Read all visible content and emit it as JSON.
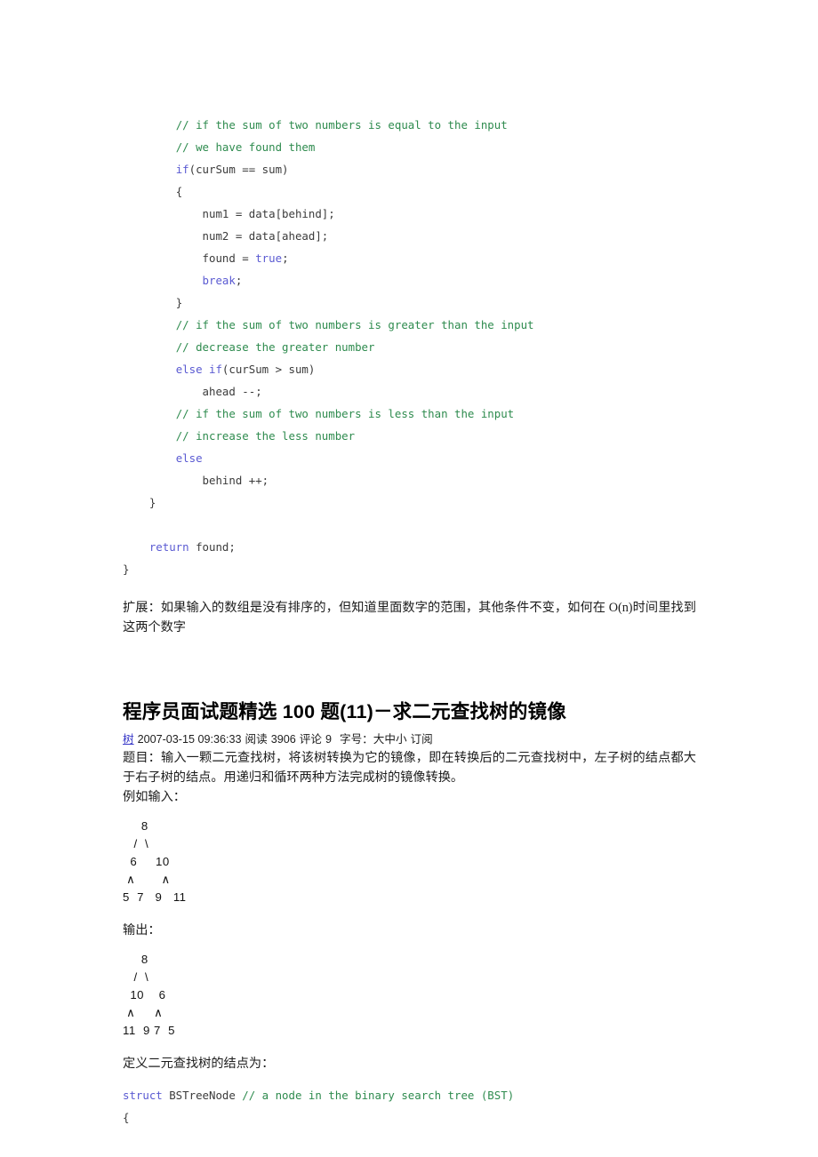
{
  "document": {
    "background_color": "#ffffff",
    "text_color": "#1d1d1d",
    "comment_color": "#2e8b4e",
    "keyword_color": "#5a5ad2",
    "link_color": "#3a3ac8"
  },
  "code_block_top": {
    "lines": [
      {
        "indent": 8,
        "segments": [
          {
            "t": "comment",
            "s": "// if the sum of two numbers is equal to the input"
          }
        ]
      },
      {
        "indent": 8,
        "segments": [
          {
            "t": "comment",
            "s": "// we have found them"
          }
        ]
      },
      {
        "indent": 8,
        "segments": [
          {
            "t": "keyword",
            "s": "if"
          },
          {
            "t": "plain",
            "s": "(curSum == sum)"
          }
        ]
      },
      {
        "indent": 8,
        "segments": [
          {
            "t": "plain",
            "s": "{"
          }
        ]
      },
      {
        "indent": 12,
        "segments": [
          {
            "t": "plain",
            "s": "num1 = data[behind];"
          }
        ]
      },
      {
        "indent": 12,
        "segments": [
          {
            "t": "plain",
            "s": "num2 = data[ahead];"
          }
        ]
      },
      {
        "indent": 12,
        "segments": [
          {
            "t": "plain",
            "s": "found = "
          },
          {
            "t": "keyword",
            "s": "true"
          },
          {
            "t": "plain",
            "s": ";"
          }
        ]
      },
      {
        "indent": 12,
        "segments": [
          {
            "t": "keyword",
            "s": "break"
          },
          {
            "t": "plain",
            "s": ";"
          }
        ]
      },
      {
        "indent": 8,
        "segments": [
          {
            "t": "plain",
            "s": "}"
          }
        ]
      },
      {
        "indent": 8,
        "segments": [
          {
            "t": "comment",
            "s": "// if the sum of two numbers is greater than the input"
          }
        ]
      },
      {
        "indent": 8,
        "segments": [
          {
            "t": "comment",
            "s": "// decrease the greater number"
          }
        ]
      },
      {
        "indent": 8,
        "segments": [
          {
            "t": "keyword",
            "s": "else if"
          },
          {
            "t": "plain",
            "s": "(curSum > sum)"
          }
        ]
      },
      {
        "indent": 12,
        "segments": [
          {
            "t": "plain",
            "s": "ahead --;"
          }
        ]
      },
      {
        "indent": 8,
        "segments": [
          {
            "t": "comment",
            "s": "// if the sum of two numbers is less than the input"
          }
        ]
      },
      {
        "indent": 8,
        "segments": [
          {
            "t": "comment",
            "s": "// increase the less number"
          }
        ]
      },
      {
        "indent": 8,
        "segments": [
          {
            "t": "keyword",
            "s": "else"
          }
        ]
      },
      {
        "indent": 12,
        "segments": [
          {
            "t": "plain",
            "s": "behind ++;"
          }
        ]
      },
      {
        "indent": 4,
        "segments": [
          {
            "t": "plain",
            "s": "}"
          }
        ]
      },
      {
        "indent": 0,
        "segments": []
      },
      {
        "indent": 4,
        "segments": [
          {
            "t": "keyword",
            "s": "return"
          },
          {
            "t": "plain",
            "s": " found;"
          }
        ]
      },
      {
        "indent": 0,
        "segments": [
          {
            "t": "plain",
            "s": "}"
          }
        ]
      }
    ]
  },
  "extension_paragraph": "扩展：如果输入的数组是没有排序的，但知道里面数字的范围，其他条件不变，如何在 O(n)时间里找到这两个数字",
  "post": {
    "title": "程序员面试题精选 100 题(11)－求二元查找树的镜像",
    "meta": {
      "category": "树",
      "datetime": "2007-03-15 09:36:33",
      "read_label": "阅读",
      "read_count": "3906",
      "comment_label": "评论",
      "comment_count": "9",
      "fontsize_label": "字号：",
      "fontsize_options": "大中小",
      "subscribe_label": "订阅"
    },
    "description": "题目：输入一颗二元查找树，将该树转换为它的镜像，即在转换后的二元查找树中，左子树的结点都大于右子树的结点。用递归和循环两种方法完成树的镜像转换。",
    "input_label": "例如输入：",
    "output_label": "输出：",
    "define_label": "定义二元查找树的结点为："
  },
  "tree_input": {
    "lines": [
      "     8",
      "   /  \\",
      "  6     10",
      " ∧       ∧",
      "5  7   9   11"
    ]
  },
  "tree_output": {
    "lines": [
      "     8",
      "   /  \\",
      "  10    6",
      " ∧     ∧",
      "11  9 7  5"
    ]
  },
  "code_block_bottom": {
    "lines": [
      {
        "indent": 0,
        "segments": [
          {
            "t": "keyword",
            "s": "struct"
          },
          {
            "t": "plain",
            "s": " BSTreeNode "
          },
          {
            "t": "comment",
            "s": "// a node in the binary search tree (BST)"
          }
        ]
      },
      {
        "indent": 0,
        "segments": [
          {
            "t": "plain",
            "s": "{"
          }
        ]
      }
    ]
  }
}
